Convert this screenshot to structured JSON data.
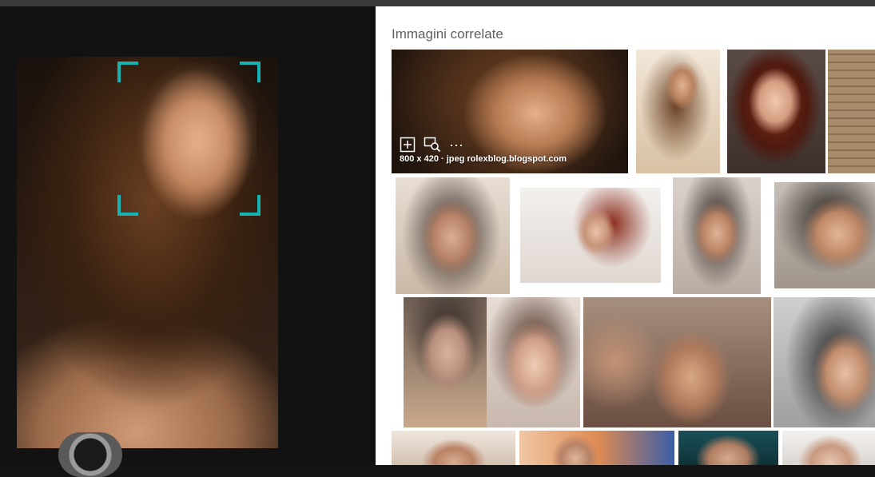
{
  "related": {
    "title": "Immagini correlate",
    "featured": {
      "info": "800 x 420 · jpeg rolexblog.blogspot.com",
      "tools": {
        "add_icon": "add-to-collection-icon",
        "visual_search_icon": "visual-search-icon",
        "more_label": "···"
      }
    }
  },
  "selection": {
    "corner_color": "#17b3b3"
  },
  "colors": {
    "left_background": "#121212",
    "right_background": "#ffffff",
    "title_color": "#5f5f5f"
  }
}
